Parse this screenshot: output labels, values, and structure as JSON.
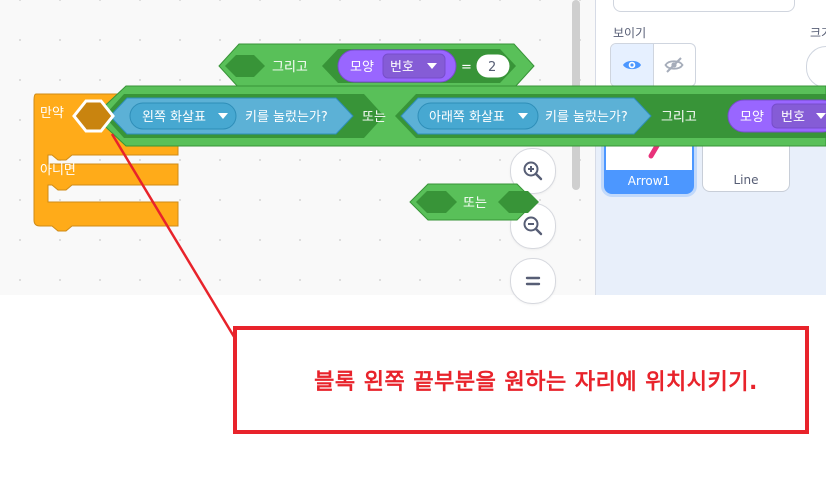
{
  "blocks": {
    "and_block": {
      "label": "그리고",
      "costume_label": "모양",
      "costume_dropdown": "번호",
      "equals": "=",
      "value": "2"
    },
    "or_block_small": {
      "label": "또는"
    },
    "if_else": {
      "if_label": "만약",
      "else_label": "아니면"
    },
    "dragged": {
      "key1_dropdown": "왼쪽 화살표",
      "key1_suffix": "키를 눌렀는가?",
      "or_label": "또는",
      "key2_dropdown": "아래쪽 화살표",
      "key2_suffix": "키를 눌렀는가?",
      "and_label": "그리고",
      "costume_label": "모양",
      "costume_dropdown": "번호"
    }
  },
  "side_panel": {
    "show_label": "보이기",
    "size_label": "크기",
    "sprites": [
      {
        "name": "Arrow1",
        "selected": true
      },
      {
        "name": "Line",
        "selected": false
      }
    ]
  },
  "annotation": {
    "text": "블록 왼쪽 끝부분을 원하는 자리에 위치시키기."
  },
  "colors": {
    "operator_green": "#59c059",
    "operator_dark": "#389438",
    "sensing_blue": "#5cb1d6",
    "looks_purple": "#9966ff",
    "control_orange": "#ffab19",
    "annotation_red": "#e8232b"
  }
}
